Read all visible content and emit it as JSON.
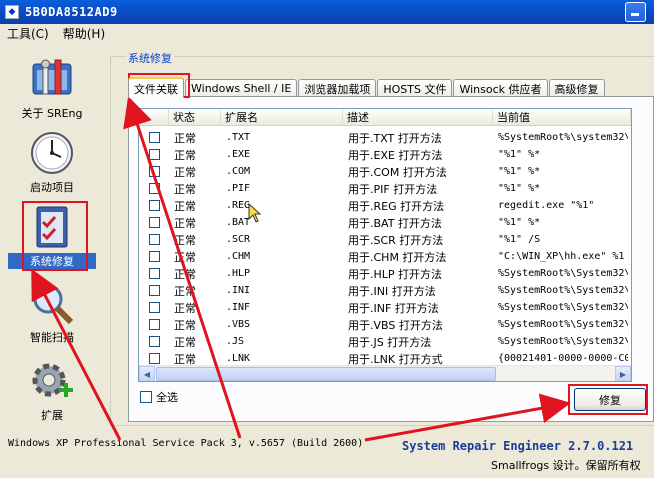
{
  "window": {
    "title": "5B0DA8512AD9"
  },
  "menu": {
    "tools": "工具(C)",
    "help": "帮助(H)"
  },
  "nav": {
    "about": "关于 SREng",
    "startup": "启动项目",
    "repair": "系统修复",
    "scan": "智能扫描",
    "extend": "扩展"
  },
  "group": {
    "label": "系统修复"
  },
  "tabs": [
    "文件关联",
    "Windows Shell / IE",
    "浏览器加载项",
    "HOSTS 文件",
    "Winsock 供应者",
    "高级修复"
  ],
  "table": {
    "headers": [
      "状态",
      "扩展名",
      "描述",
      "当前值"
    ],
    "rows": [
      {
        "status": "正常",
        "ext": ".TXT",
        "desc": "用于.TXT 打开方法",
        "value": "%SystemRoot%\\system32\\"
      },
      {
        "status": "正常",
        "ext": ".EXE",
        "desc": "用于.EXE 打开方法",
        "value": "\"%1\" %*"
      },
      {
        "status": "正常",
        "ext": ".COM",
        "desc": "用于.COM 打开方法",
        "value": "\"%1\" %*"
      },
      {
        "status": "正常",
        "ext": ".PIF",
        "desc": "用于.PIF 打开方法",
        "value": "\"%1\" %*"
      },
      {
        "status": "正常",
        "ext": ".REG",
        "desc": "用于.REG 打开方法",
        "value": "regedit.exe \"%1\""
      },
      {
        "status": "正常",
        "ext": ".BAT",
        "desc": "用于.BAT 打开方法",
        "value": "\"%1\" %*"
      },
      {
        "status": "正常",
        "ext": ".SCR",
        "desc": "用于.SCR 打开方法",
        "value": "\"%1\" /S"
      },
      {
        "status": "正常",
        "ext": ".CHM",
        "desc": "用于.CHM 打开方法",
        "value": "\"C:\\WIN_XP\\hh.exe\" %1"
      },
      {
        "status": "正常",
        "ext": ".HLP",
        "desc": "用于.HLP 打开方法",
        "value": "%SystemRoot%\\System32\\"
      },
      {
        "status": "正常",
        "ext": ".INI",
        "desc": "用于.INI 打开方法",
        "value": "%SystemRoot%\\System32\\"
      },
      {
        "status": "正常",
        "ext": ".INF",
        "desc": "用于.INF 打开方法",
        "value": "%SystemRoot%\\System32\\"
      },
      {
        "status": "正常",
        "ext": ".VBS",
        "desc": "用于.VBS 打开方法",
        "value": "%SystemRoot%\\System32\\"
      },
      {
        "status": "正常",
        "ext": ".JS",
        "desc": "用于.JS 打开方法",
        "value": "%SystemRoot%\\System32\\"
      },
      {
        "status": "正常",
        "ext": ".LNK",
        "desc": "用于.LNK 打开方式",
        "value": "{00021401-0000-0000-C00"
      }
    ]
  },
  "select_all": "全选",
  "repair_button": "修复",
  "status": {
    "os": "Windows XP Professional Service Pack 3, v.5657 (Build 2600)",
    "app": "System Repair Engineer 2.7.0.121",
    "copyright": "Smallfrogs 设计。保留所有权"
  },
  "colors": {
    "annotation": "#e0141e",
    "titlebar": "#0b4fc9",
    "link": "#0046d5"
  }
}
